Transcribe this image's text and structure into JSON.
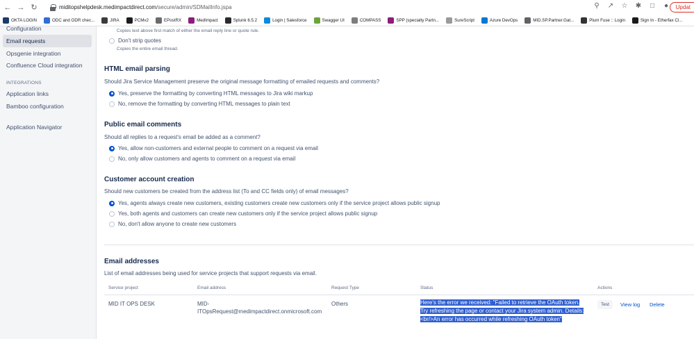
{
  "browser": {
    "url_host": "miditopshelpdesk.medimpactdirect.com",
    "url_path": "/secure/admin/SDMailInfo.jspa",
    "update_label": "Updat",
    "bookmarks": [
      {
        "label": "OKTA LOGIN",
        "icon": "okta-icon",
        "color": "#1d3b6a"
      },
      {
        "label": "ODC and ODR chec...",
        "icon": "doc-icon",
        "color": "#2f6fd6"
      },
      {
        "label": "JIRA",
        "icon": "jira-icon",
        "color": "#3b3b3b"
      },
      {
        "label": "PCMv2",
        "icon": "pcm-icon",
        "color": "#1c1c1c"
      },
      {
        "label": "EPostRX",
        "icon": "epostrx-icon",
        "color": "#6b6b6b"
      },
      {
        "label": "MedImpact",
        "icon": "medimpact-icon",
        "color": "#8a1e7b"
      },
      {
        "label": "Splunk 6.5.2",
        "icon": "splunk-icon",
        "color": "#2a2a2a"
      },
      {
        "label": "Login | Salesforce",
        "icon": "salesforce-icon",
        "color": "#0f8ad8"
      },
      {
        "label": "Swagger UI",
        "icon": "swagger-icon",
        "color": "#6ba539"
      },
      {
        "label": "COMPASS",
        "icon": "compass-icon",
        "color": "#7d7d7d"
      },
      {
        "label": "SPP (specialty Partn...",
        "icon": "spp-icon",
        "color": "#8a1e7b"
      },
      {
        "label": "SureScript",
        "icon": "surescript-icon",
        "color": "#9a9a9a"
      },
      {
        "label": "Azure DevOps",
        "icon": "azure-icon",
        "color": "#0078d4"
      },
      {
        "label": "MID.SP.Partner.Gat...",
        "icon": "globe-icon",
        "color": "#5f6368"
      },
      {
        "label": "Plum Fuse :: Login",
        "icon": "plum-icon",
        "color": "#333333"
      },
      {
        "label": "Sign In - Etherfax Cl...",
        "icon": "etherfax-icon",
        "color": "#1a1a1a"
      }
    ]
  },
  "sidebar": {
    "items": [
      {
        "label": "Configuration",
        "active": false
      },
      {
        "label": "Email requests",
        "active": true
      },
      {
        "label": "Opsgenie integration",
        "active": false
      },
      {
        "label": "Confluence Cloud integration",
        "active": false
      }
    ],
    "integrations_heading": "INTEGRATIONS",
    "integrations": [
      {
        "label": "Application links"
      },
      {
        "label": "Bamboo configuration"
      }
    ],
    "navigator": "Application Navigator"
  },
  "main": {
    "strip_desc_1": "Copies text above first match of either the email reply line or quote rule.",
    "dont_strip_label": "Don't strip quotes",
    "dont_strip_desc": "Copies the entire email thread.",
    "html_parsing": {
      "title": "HTML email parsing",
      "question": "Should Jira Service Management preserve the original message formatting of emailed requests and comments?",
      "options": [
        {
          "label": "Yes, preserve the formatting by converting HTML messages to Jira wiki markup",
          "selected": true
        },
        {
          "label": "No, remove the formatting by converting HTML messages to plain text",
          "selected": false
        }
      ]
    },
    "public_comments": {
      "title": "Public email comments",
      "question": "Should all replies to a request's email be added as a comment?",
      "options": [
        {
          "label": "Yes, allow non-customers and external people to comment on a request via email",
          "selected": true
        },
        {
          "label": "No, only allow customers and agents to comment on a request via email",
          "selected": false
        }
      ]
    },
    "customer_creation": {
      "title": "Customer account creation",
      "question": "Should new customers be created from the address list (To and CC fields only) of email messages?",
      "options": [
        {
          "label": "Yes, agents always create new customers, existing customers create new customers only if the service project allows public signup",
          "selected": true
        },
        {
          "label": "Yes, both agents and customers can create new customers only if the service project allows public signup",
          "selected": false
        },
        {
          "label": "No, don't allow anyone to create new customers",
          "selected": false
        }
      ]
    },
    "email_addresses": {
      "title": "Email addresses",
      "description": "List of email addresses being used for service projects that support requests via email.",
      "columns": [
        "Service project",
        "Email address",
        "Request Type",
        "Status",
        "Actions"
      ],
      "row": {
        "project": "MID IT OPS DESK",
        "email_line1": "MID-",
        "email_line2": "ITOpsRequest@medimpactdirect.onmicrosoft.com",
        "request_type": "Others",
        "status_line1": "Here's the error we received: \"Failed to retrieve the OAuth token.",
        "status_line2": "Try refreshing the page or contact your Jira system admin. Details:",
        "status_line3": "<br/>An error has occurred while refreshing OAuth token\"",
        "test_label": "Test",
        "viewlog_label": "View log",
        "delete_label": "Delete"
      }
    }
  }
}
